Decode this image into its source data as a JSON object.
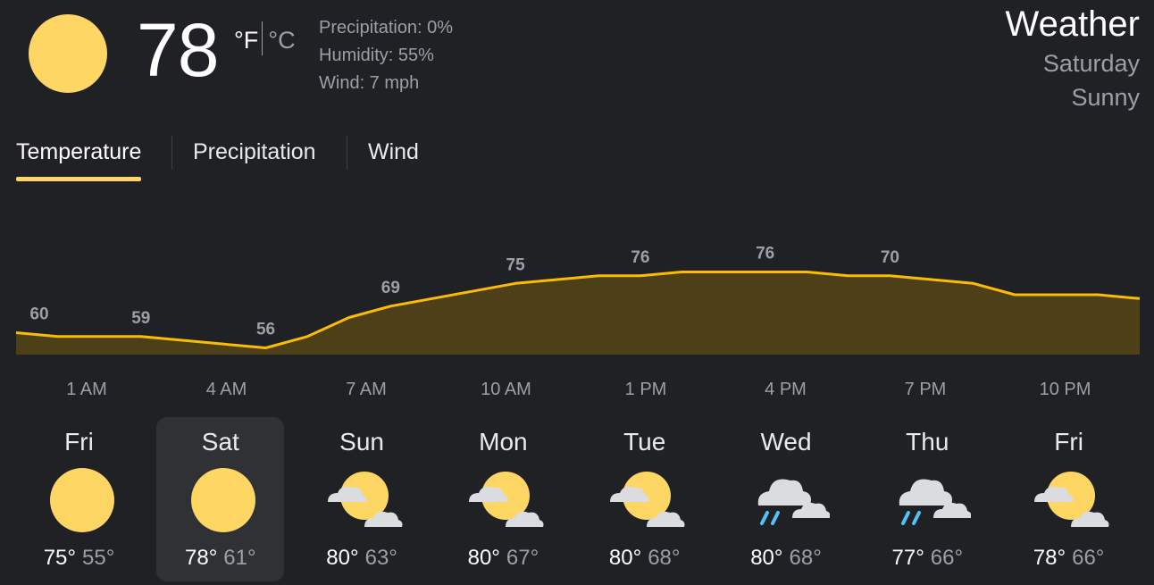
{
  "current": {
    "temperature": "78",
    "unit_f": "°F",
    "unit_c": "°C",
    "icon": "sun-icon",
    "precipitation": "Precipitation: 0%",
    "humidity": "Humidity: 55%",
    "wind": "Wind: 7 mph"
  },
  "header": {
    "title": "Weather",
    "day": "Saturday",
    "condition": "Sunny"
  },
  "tabs": [
    {
      "label": "Temperature",
      "active": true
    },
    {
      "label": "Precipitation",
      "active": false
    },
    {
      "label": "Wind",
      "active": false
    }
  ],
  "colors": {
    "accent": "#fdd663",
    "line": "#fbbc04",
    "fill": "#4d4019",
    "background": "#202124",
    "selected_day": "#303134",
    "rain": "#4fc3f7"
  },
  "chart_data": {
    "type": "area",
    "series": [
      {
        "values": [
          60,
          59,
          59,
          59,
          58,
          57,
          56,
          59,
          64,
          67,
          69,
          71,
          73,
          74,
          75,
          75,
          76,
          76,
          76,
          76,
          75,
          75,
          74,
          73,
          70,
          70,
          70,
          69
        ]
      }
    ],
    "value_labels": [
      {
        "index": 0,
        "text": "60"
      },
      {
        "index": 3,
        "text": "59"
      },
      {
        "index": 6,
        "text": "56"
      },
      {
        "index": 9,
        "text": "69"
      },
      {
        "index": 12,
        "text": "75"
      },
      {
        "index": 15,
        "text": "76"
      },
      {
        "index": 18,
        "text": "76"
      },
      {
        "index": 21,
        "text": "70"
      }
    ],
    "time_labels": [
      "1 AM",
      "4 AM",
      "7 AM",
      "10 AM",
      "1 PM",
      "4 PM",
      "7 PM",
      "10 PM"
    ]
  },
  "forecast": [
    {
      "day": "Fri",
      "icon": "sun-icon",
      "high": "75°",
      "low": "55°",
      "selected": false
    },
    {
      "day": "Sat",
      "icon": "sun-icon",
      "high": "78°",
      "low": "61°",
      "selected": true
    },
    {
      "day": "Sun",
      "icon": "partly-cloudy-icon",
      "high": "80°",
      "low": "63°",
      "selected": false
    },
    {
      "day": "Mon",
      "icon": "partly-cloudy-icon",
      "high": "80°",
      "low": "67°",
      "selected": false
    },
    {
      "day": "Tue",
      "icon": "partly-cloudy-icon",
      "high": "80°",
      "low": "68°",
      "selected": false
    },
    {
      "day": "Wed",
      "icon": "rain-cloud-icon",
      "high": "80°",
      "low": "68°",
      "selected": false
    },
    {
      "day": "Thu",
      "icon": "rain-cloud-icon",
      "high": "77°",
      "low": "66°",
      "selected": false
    },
    {
      "day": "Fri",
      "icon": "partly-cloudy-icon",
      "high": "78°",
      "low": "66°",
      "selected": false
    }
  ]
}
